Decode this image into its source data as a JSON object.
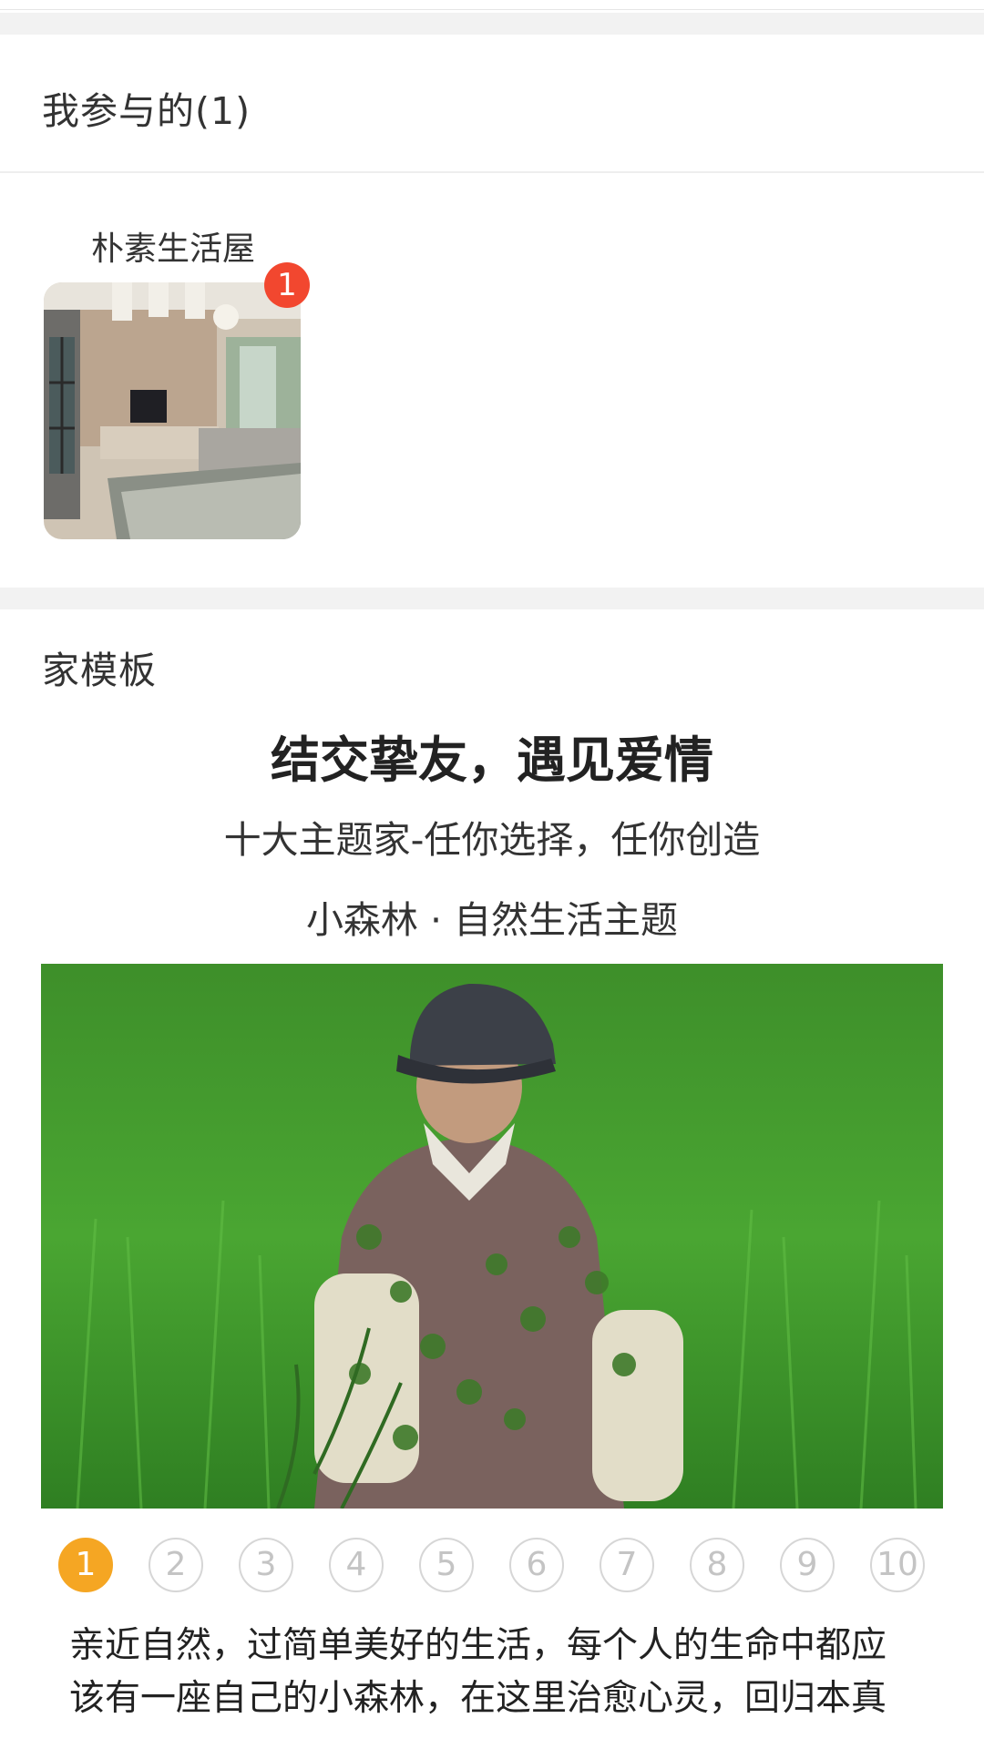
{
  "participated": {
    "title": "我参与的(1)",
    "home": {
      "name": "朴素生活屋",
      "badge": "1"
    }
  },
  "templates": {
    "title": "家模板",
    "headline": "结交挚友，遇见爱情",
    "subheadline": "十大主题家-任你选择，任你创造",
    "theme_title": "小森林 · 自然生活主题",
    "pages": [
      "1",
      "2",
      "3",
      "4",
      "5",
      "6",
      "7",
      "8",
      "9",
      "10"
    ],
    "active_page": "1",
    "description": "亲近自然，过简单美好的生活，每个人的生命中都应该有一座自己的小森林，在这里治愈心灵，回归本真"
  },
  "colors": {
    "badge": "#f2472f",
    "active_dot": "#f5a623",
    "band": "#f2f2f2"
  }
}
